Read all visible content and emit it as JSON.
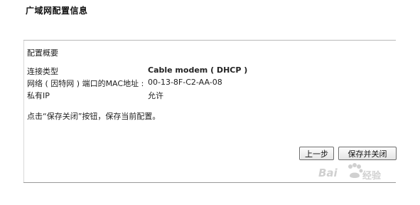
{
  "page": {
    "title": "广域网配置信息"
  },
  "summary": {
    "section_title": "配置概要",
    "rows": [
      {
        "label": "连接类型",
        "value": "Cable modem ( DHCP )"
      },
      {
        "label": "网络 ( 因特网 ) 端口的MAC地址 :",
        "value": "00-13-8F-C2-AA-08"
      },
      {
        "label": "私有IP",
        "value": "允许"
      }
    ],
    "instruction": "点击“保存关闭”按钮，保存当前配置。"
  },
  "buttons": {
    "prev": "上一步",
    "save_close": "保存并关闭"
  },
  "watermark": {
    "brand": "Bai",
    "suffix": "经验",
    "icon": "baidu-paw-icon"
  }
}
